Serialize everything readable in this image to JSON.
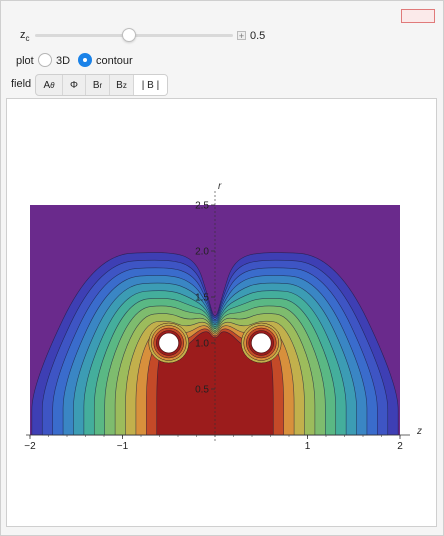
{
  "controls": {
    "zc_label": "z",
    "zc_sub": "c",
    "zc_value": "0.5",
    "zc_fraction": 0.5,
    "plot_label": "plot",
    "plot_options": [
      "3D",
      "contour"
    ],
    "plot_selected": "contour",
    "field_label": "field",
    "field_options": [
      "A",
      "Φ",
      "B",
      "B",
      "| B |"
    ],
    "field_subs": [
      "θ",
      "",
      "r",
      "z",
      ""
    ],
    "field_selected": "| B |"
  },
  "chart_data": {
    "type": "contour",
    "xlabel": "z",
    "ylabel": "r",
    "xlim": [
      -2,
      2
    ],
    "ylim": [
      0,
      2.5
    ],
    "x_ticks": [
      "−2",
      "−1",
      "1",
      "2"
    ],
    "y_ticks": [
      "0.5",
      "1.0",
      "1.5",
      "2.0",
      "2.5"
    ],
    "loops": [
      {
        "z": -0.5,
        "r": 1.0
      },
      {
        "z": 0.5,
        "r": 1.0
      }
    ],
    "colors": {
      "background": "#6a2a8c",
      "levels": [
        "#3e3fb4",
        "#3e55c4",
        "#3a6ccc",
        "#3a86c4",
        "#3c9cb4",
        "#44ae9c",
        "#5ab884",
        "#7ebc6e",
        "#9cbc5c",
        "#c2b04c",
        "#d8903c",
        "#c44a28",
        "#9c1c1c"
      ]
    }
  }
}
